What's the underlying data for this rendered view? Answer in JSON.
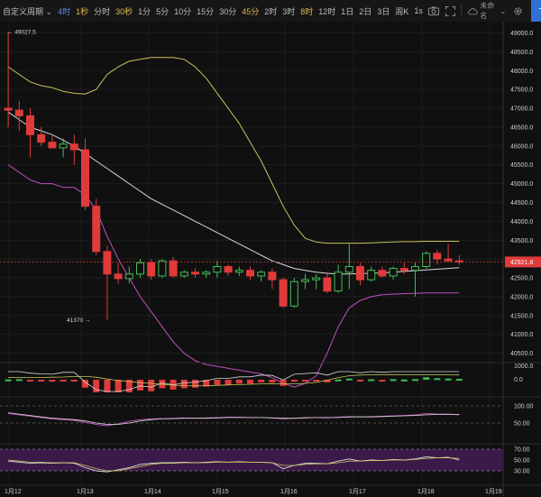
{
  "toolbar": {
    "custom_period": "自定义周期",
    "active_interval": "4时",
    "intervals": [
      "1秒",
      "分时",
      "30秒",
      "1分",
      "5分",
      "10分",
      "15分",
      "30分",
      "45分",
      "2时",
      "3时",
      "8时",
      "12时",
      "1日",
      "2日",
      "3日",
      "周K"
    ],
    "highlight_intervals": [
      "4时",
      "1秒",
      "30秒",
      "45分",
      "8时"
    ],
    "right_interval": "1s",
    "cloud_label": "未命名",
    "order_button": "下单"
  },
  "chart_data": {
    "type": "candlestick",
    "price_axis": {
      "ticks": [
        49000,
        48500,
        48000,
        47500,
        47000,
        46500,
        46000,
        45500,
        45000,
        44500,
        44000,
        43500,
        43000,
        42500,
        42000,
        41500,
        41000,
        40500
      ],
      "range": [
        40250,
        49300
      ],
      "tick_labels": [
        "49000.0",
        "48500.0",
        "48000.0",
        "47500.0",
        "47000.0",
        "46500.0",
        "46000.0",
        "45500.0",
        "45000.0",
        "44500.0",
        "44000.0",
        "43500.0",
        "43000.0",
        "42500.0",
        "42000.0",
        "41500.0",
        "41000.0",
        "40500.0"
      ]
    },
    "current_price": {
      "value": 42921.8,
      "label": "42921.8",
      "color": "#e03b3b"
    },
    "annotations": {
      "high": {
        "value": 49027.5,
        "label": "49027.5"
      },
      "low": {
        "value": 41370,
        "label": "41370"
      }
    },
    "time_axis": [
      "1月12",
      "1月13",
      "1月14",
      "1月15",
      "1月16",
      "1月17",
      "1月18",
      "1月19"
    ],
    "candles": [
      {
        "o": 47000,
        "h": 49027,
        "l": 46500,
        "c": 46950
      },
      {
        "o": 46950,
        "h": 47200,
        "l": 46400,
        "c": 46800
      },
      {
        "o": 46800,
        "h": 47000,
        "l": 45700,
        "c": 46300
      },
      {
        "o": 46300,
        "h": 46500,
        "l": 46000,
        "c": 46100
      },
      {
        "o": 46100,
        "h": 46300,
        "l": 46000,
        "c": 45950
      },
      {
        "o": 45950,
        "h": 46200,
        "l": 45700,
        "c": 46050
      },
      {
        "o": 46050,
        "h": 46300,
        "l": 45500,
        "c": 45900
      },
      {
        "o": 45900,
        "h": 46200,
        "l": 44300,
        "c": 44400
      },
      {
        "o": 44400,
        "h": 44600,
        "l": 43100,
        "c": 43200
      },
      {
        "o": 43200,
        "h": 43350,
        "l": 41370,
        "c": 42600
      },
      {
        "o": 42600,
        "h": 42900,
        "l": 42350,
        "c": 42480
      },
      {
        "o": 42480,
        "h": 42800,
        "l": 42350,
        "c": 42600
      },
      {
        "o": 42600,
        "h": 43000,
        "l": 42500,
        "c": 42900
      },
      {
        "o": 42900,
        "h": 43000,
        "l": 42450,
        "c": 42550
      },
      {
        "o": 42550,
        "h": 43000,
        "l": 42500,
        "c": 42950
      },
      {
        "o": 42950,
        "h": 43050,
        "l": 42500,
        "c": 42550
      },
      {
        "o": 42550,
        "h": 42700,
        "l": 42500,
        "c": 42650
      },
      {
        "o": 42650,
        "h": 42750,
        "l": 42500,
        "c": 42600
      },
      {
        "o": 42600,
        "h": 42700,
        "l": 42500,
        "c": 42650
      },
      {
        "o": 42650,
        "h": 42950,
        "l": 42500,
        "c": 42800
      },
      {
        "o": 42800,
        "h": 42850,
        "l": 42550,
        "c": 42650
      },
      {
        "o": 42650,
        "h": 42800,
        "l": 42550,
        "c": 42700
      },
      {
        "o": 42700,
        "h": 42800,
        "l": 42450,
        "c": 42550
      },
      {
        "o": 42550,
        "h": 42700,
        "l": 42400,
        "c": 42650
      },
      {
        "o": 42650,
        "h": 42750,
        "l": 42200,
        "c": 42450
      },
      {
        "o": 42450,
        "h": 42500,
        "l": 41700,
        "c": 41750
      },
      {
        "o": 41750,
        "h": 42500,
        "l": 41700,
        "c": 42400
      },
      {
        "o": 42400,
        "h": 42600,
        "l": 42200,
        "c": 42450
      },
      {
        "o": 42450,
        "h": 42600,
        "l": 42200,
        "c": 42500
      },
      {
        "o": 42500,
        "h": 42600,
        "l": 42100,
        "c": 42150
      },
      {
        "o": 42150,
        "h": 42850,
        "l": 42100,
        "c": 42650
      },
      {
        "o": 42650,
        "h": 43400,
        "l": 42200,
        "c": 42800
      },
      {
        "o": 42800,
        "h": 42900,
        "l": 42300,
        "c": 42450
      },
      {
        "o": 42450,
        "h": 42800,
        "l": 42400,
        "c": 42700
      },
      {
        "o": 42700,
        "h": 42800,
        "l": 42500,
        "c": 42550
      },
      {
        "o": 42550,
        "h": 42800,
        "l": 42450,
        "c": 42750
      },
      {
        "o": 42750,
        "h": 42900,
        "l": 42600,
        "c": 42700
      },
      {
        "o": 42700,
        "h": 42900,
        "l": 42000,
        "c": 42800
      },
      {
        "o": 42800,
        "h": 43200,
        "l": 42750,
        "c": 43150
      },
      {
        "o": 43150,
        "h": 43250,
        "l": 42850,
        "c": 43000
      },
      {
        "o": 43000,
        "h": 43400,
        "l": 42950,
        "c": 42950
      },
      {
        "o": 42950,
        "h": 43100,
        "l": 42850,
        "c": 42921.8
      }
    ],
    "bollinger": {
      "upper": [
        48100,
        47900,
        47700,
        47600,
        47550,
        47450,
        47400,
        47380,
        47500,
        47900,
        48100,
        48250,
        48300,
        48350,
        48350,
        48350,
        48300,
        48100,
        47800,
        47400,
        47000,
        46600,
        46100,
        45600,
        45000,
        44400,
        43900,
        43550,
        43450,
        43420,
        43420,
        43420,
        43420,
        43430,
        43440,
        43450,
        43460,
        43460,
        43470,
        43470,
        43470,
        43470
      ],
      "middle": [
        46900,
        46700,
        46500,
        46400,
        46300,
        46150,
        46000,
        45800,
        45600,
        45400,
        45200,
        45000,
        44800,
        44600,
        44450,
        44300,
        44150,
        44000,
        43850,
        43700,
        43550,
        43400,
        43250,
        43100,
        42950,
        42850,
        42750,
        42700,
        42650,
        42620,
        42600,
        42600,
        42610,
        42620,
        42630,
        42650,
        42670,
        42690,
        42710,
        42730,
        42750,
        42770
      ],
      "lower": [
        45500,
        45300,
        45100,
        45000,
        45000,
        44900,
        44900,
        44700,
        44300,
        43600,
        43000,
        42500,
        42000,
        41600,
        41200,
        40800,
        40500,
        40300,
        40200,
        40150,
        40100,
        40050,
        40000,
        39950,
        39850,
        39700,
        39600,
        39700,
        39900,
        40500,
        41200,
        41700,
        41900,
        42000,
        42050,
        42070,
        42080,
        42090,
        42100,
        42100,
        42100,
        42100
      ]
    },
    "volume_panel": {
      "ticks": [
        1000.0,
        0.0
      ],
      "tick_labels": [
        "1000.0",
        "0.0"
      ]
    },
    "oscillator_panel": {
      "ticks": [
        100.0,
        50.0
      ],
      "tick_labels": [
        "100.00",
        "50.00"
      ]
    },
    "rsi_panel": {
      "ticks": [
        70.0,
        50.0,
        30.0
      ],
      "tick_labels": [
        "70.00",
        "50.00",
        "30.00"
      ]
    }
  }
}
